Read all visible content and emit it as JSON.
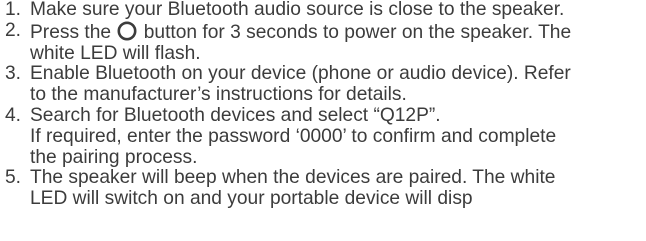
{
  "steps": [
    {
      "number": "1.",
      "lines": [
        "Make sure your Bluetooth audio source is close to the speaker."
      ]
    },
    {
      "number": "2.",
      "line1_before_icon": "Press the",
      "icon": "power-button-icon",
      "line1_after_icon": "button for 3 seconds to power on the speaker. The",
      "lines": [
        "white LED will flash."
      ]
    },
    {
      "number": "3.",
      "lines": [
        "Enable Bluetooth on your device (phone or audio device). Refer",
        "to the manufacturer’s instructions for details."
      ]
    },
    {
      "number": "4.",
      "lines": [
        "Search for Bluetooth devices and select “Q12P”.",
        "If required, enter the password ‘0000’ to confirm and complete",
        "the pairing process."
      ]
    },
    {
      "number": "5.",
      "lines": [
        "The speaker will beep when the devices are paired. The white",
        "LED will switch on and your portable device will disp"
      ]
    }
  ]
}
